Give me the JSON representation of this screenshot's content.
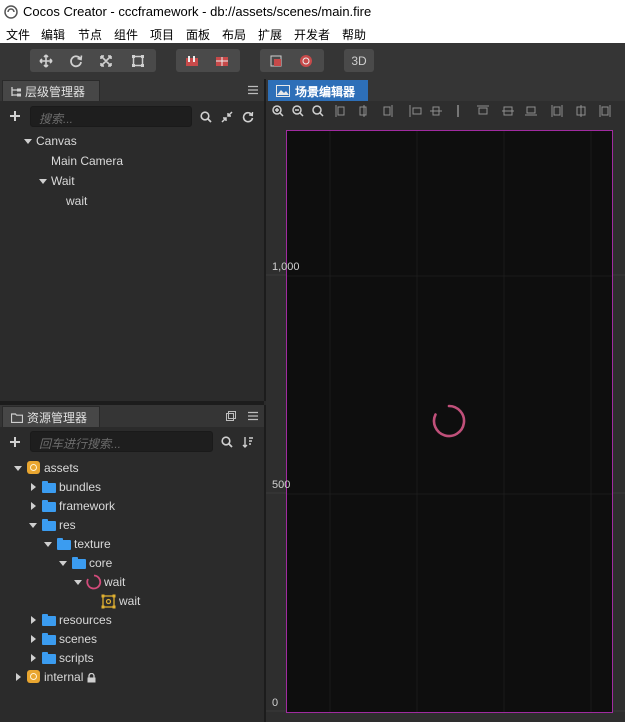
{
  "window": {
    "title": "Cocos Creator - cccframework - db://assets/scenes/main.fire"
  },
  "menu": [
    "文件",
    "编辑",
    "节点",
    "组件",
    "项目",
    "面板",
    "布局",
    "扩展",
    "开发者",
    "帮助"
  ],
  "toolbar": {
    "transform_tools": [
      "move-tool-icon",
      "rotate-tool-icon",
      "scale-tool-icon",
      "rect-tool-icon"
    ],
    "pivot_tools": [
      "pivot-icon",
      "local-icon"
    ],
    "preview_tools": [
      "preview-device-icon",
      "record-icon"
    ],
    "mode_3d_label": "3D"
  },
  "hierarchy": {
    "tab_label": "层级管理器",
    "search_placeholder": "搜索...",
    "nodes": [
      {
        "label": "Canvas",
        "depth": 0,
        "expanded": true
      },
      {
        "label": "Main Camera",
        "depth": 1
      },
      {
        "label": "Wait",
        "depth": 1,
        "expanded": true
      },
      {
        "label": "wait",
        "depth": 2
      }
    ]
  },
  "assets": {
    "tab_label": "资源管理器",
    "search_placeholder": "回车进行搜索...",
    "tree": [
      {
        "label": "assets",
        "icon": "database-icon",
        "state": "expanded",
        "depth": 0
      },
      {
        "label": "bundles",
        "icon": "folder-icon",
        "state": "collapsed",
        "depth": 1
      },
      {
        "label": "framework",
        "icon": "folder-icon",
        "state": "collapsed",
        "depth": 1
      },
      {
        "label": "res",
        "icon": "folder-icon",
        "state": "expanded",
        "depth": 1
      },
      {
        "label": "texture",
        "icon": "folder-icon",
        "state": "expanded",
        "depth": 2
      },
      {
        "label": "core",
        "icon": "folder-icon",
        "state": "expanded",
        "depth": 3
      },
      {
        "label": "wait",
        "icon": "spinner-texture-icon",
        "state": "expanded",
        "depth": 4
      },
      {
        "label": "wait",
        "icon": "sprite-frame-icon",
        "state": "leaf",
        "depth": 5
      },
      {
        "label": "resources",
        "icon": "folder-icon",
        "state": "collapsed",
        "depth": 1
      },
      {
        "label": "scenes",
        "icon": "folder-icon",
        "state": "collapsed",
        "depth": 1
      },
      {
        "label": "scripts",
        "icon": "folder-icon",
        "state": "collapsed",
        "depth": 1
      },
      {
        "label": "internal",
        "icon": "database-icon",
        "state": "collapsed",
        "depth": 0,
        "locked": true
      }
    ]
  },
  "scene_editor": {
    "tab_label": "场景编辑器",
    "ruler_labels": [
      "1,000",
      "500",
      "0"
    ],
    "zoom_tools": [
      "zoom-in-icon",
      "zoom-out-icon",
      "zoom-reset-icon"
    ],
    "colors": {
      "canvas_border": "#a02ba0",
      "spinner": "#c0507a",
      "tab_active": "#2d6fb8"
    }
  }
}
